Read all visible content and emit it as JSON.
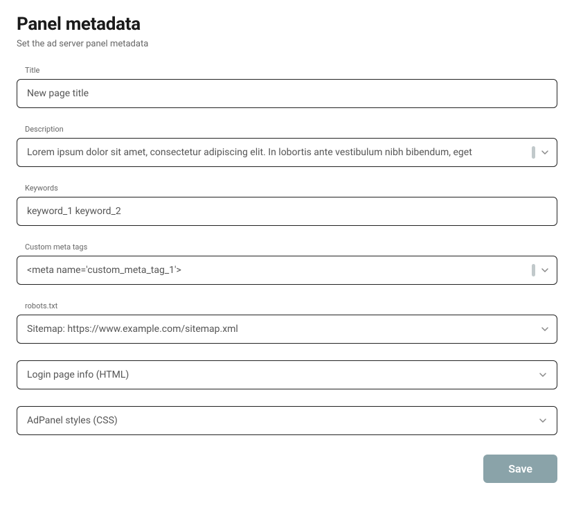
{
  "header": {
    "title": "Panel metadata",
    "subtitle": "Set the ad server panel metadata"
  },
  "fields": {
    "titleField": {
      "label": "Title",
      "value": "New page title"
    },
    "descriptionField": {
      "label": "Description",
      "value": "Lorem ipsum dolor sit amet, consectetur adipiscing elit. In lobortis ante vestibulum nibh bibendum, eget"
    },
    "keywordsField": {
      "label": "Keywords",
      "value": "keyword_1 keyword_2"
    },
    "customMetaField": {
      "label": "Custom meta tags",
      "value": "<meta name='custom_meta_tag_1'>"
    },
    "robotsField": {
      "label": "robots.txt",
      "value": "Sitemap: https://www.example.com/sitemap.xml"
    }
  },
  "collapsibles": {
    "loginPage": {
      "label": "Login page info (HTML)"
    },
    "adPanelStyles": {
      "label": "AdPanel styles (CSS)"
    }
  },
  "actions": {
    "save": "Save"
  }
}
